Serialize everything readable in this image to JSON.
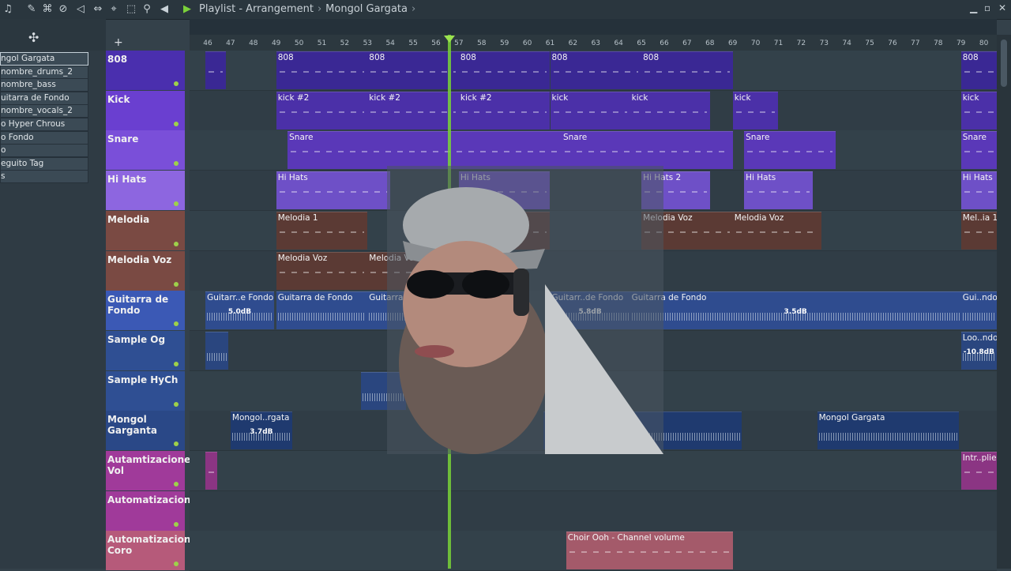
{
  "titlebar": {
    "crumb": [
      "Playlist - Arrangement",
      "Mongol Gargata"
    ]
  },
  "ruler": [
    46,
    47,
    48,
    49,
    50,
    51,
    52,
    53,
    54,
    55,
    56,
    57,
    58,
    59,
    60,
    61,
    62,
    63,
    64,
    65,
    66,
    67,
    68,
    69,
    70,
    71,
    72,
    73,
    74,
    75,
    76,
    77,
    78,
    79,
    80
  ],
  "picker": [
    "ngol Gargata",
    "nombre_drums_2",
    "nombre_bass",
    "uitarra de Fondo",
    "nombre_vocals_2",
    "o Hyper Chrous",
    "o Fondo",
    "o",
    "eguito Tag",
    "s"
  ],
  "tracks": [
    {
      "name": "808",
      "color": "#4a2fae"
    },
    {
      "name": "Kick",
      "color": "#6a3fd0"
    },
    {
      "name": "Snare",
      "color": "#7a4fd9"
    },
    {
      "name": "Hi Hats",
      "color": "#8d66e0"
    },
    {
      "name": "Melodia",
      "color": "#7a4a43"
    },
    {
      "name": "Melodia Voz",
      "color": "#7a4a43"
    },
    {
      "name": "Guitarra de Fondo",
      "color": "#3b59b5"
    },
    {
      "name": "Sample Og",
      "color": "#2f4f93"
    },
    {
      "name": "Sample HyCh",
      "color": "#2f4f93"
    },
    {
      "name": "Mongol Garganta",
      "color": "#2a4887"
    },
    {
      "name": "Autamtizaciones Vol",
      "color": "#a03a9a"
    },
    {
      "name": "Automatizaciones",
      "color": "#a03a9a"
    },
    {
      "name": "Automatizaciones Coro",
      "color": "#b65a7a"
    }
  ],
  "clips": [
    {
      "track": 0,
      "label": "",
      "start": 45.9,
      "len": 0.9,
      "kind": "pattern",
      "color": "#3a2894"
    },
    {
      "track": 0,
      "label": "808",
      "start": 49,
      "len": 4,
      "kind": "pattern",
      "color": "#3a2894"
    },
    {
      "track": 0,
      "label": "808",
      "start": 53,
      "len": 4,
      "kind": "pattern",
      "color": "#3a2894"
    },
    {
      "track": 0,
      "label": "808",
      "start": 57,
      "len": 4,
      "kind": "pattern",
      "color": "#3a2894"
    },
    {
      "track": 0,
      "label": "808",
      "start": 61,
      "len": 4,
      "kind": "pattern",
      "color": "#3a2894"
    },
    {
      "track": 0,
      "label": "808",
      "start": 65,
      "len": 4,
      "kind": "pattern",
      "color": "#3a2894"
    },
    {
      "track": 0,
      "label": "808",
      "start": 79,
      "len": 2,
      "kind": "pattern",
      "color": "#3a2894"
    },
    {
      "track": 1,
      "label": "kick #2",
      "start": 49,
      "len": 4,
      "kind": "pattern",
      "color": "#4b30a8"
    },
    {
      "track": 1,
      "label": "kick #2",
      "start": 53,
      "len": 4,
      "kind": "pattern",
      "color": "#4b30a8"
    },
    {
      "track": 1,
      "label": "kick #2",
      "start": 57,
      "len": 4,
      "kind": "pattern",
      "color": "#4b30a8"
    },
    {
      "track": 1,
      "label": "kick",
      "start": 61,
      "len": 3.5,
      "kind": "pattern",
      "color": "#4b30a8"
    },
    {
      "track": 1,
      "label": "kick",
      "start": 64.5,
      "len": 3.5,
      "kind": "pattern",
      "color": "#4b30a8"
    },
    {
      "track": 1,
      "label": "kick",
      "start": 69,
      "len": 2,
      "kind": "pattern",
      "color": "#4b30a8"
    },
    {
      "track": 1,
      "label": "kick",
      "start": 79,
      "len": 2,
      "kind": "pattern",
      "color": "#4b30a8"
    },
    {
      "track": 2,
      "label": "Snare",
      "start": 49.5,
      "len": 12,
      "kind": "pattern",
      "color": "#5a38b8"
    },
    {
      "track": 2,
      "label": "Snare",
      "start": 61.5,
      "len": 7.5,
      "kind": "pattern",
      "color": "#5a38b8"
    },
    {
      "track": 2,
      "label": "Snare",
      "start": 69.5,
      "len": 4,
      "kind": "pattern",
      "color": "#5a38b8"
    },
    {
      "track": 2,
      "label": "Snare",
      "start": 79,
      "len": 2,
      "kind": "pattern",
      "color": "#5a38b8"
    },
    {
      "track": 3,
      "label": "Hi Hats",
      "start": 49,
      "len": 5,
      "kind": "pattern",
      "color": "#6e50c7"
    },
    {
      "track": 3,
      "label": "Hi Hats",
      "start": 57,
      "len": 4,
      "kind": "pattern",
      "color": "#6e50c7"
    },
    {
      "track": 3,
      "label": "Hi Hats 2",
      "start": 65,
      "len": 3,
      "kind": "pattern",
      "color": "#6e50c7"
    },
    {
      "track": 3,
      "label": "Hi Hats",
      "start": 69.5,
      "len": 3,
      "kind": "pattern",
      "color": "#6e50c7"
    },
    {
      "track": 3,
      "label": "Hi Hats",
      "start": 79,
      "len": 2,
      "kind": "pattern",
      "color": "#6e50c7"
    },
    {
      "track": 4,
      "label": "Melodia 1",
      "start": 49,
      "len": 4,
      "kind": "pattern",
      "color": "#5b3a34"
    },
    {
      "track": 4,
      "label": "",
      "start": 57,
      "len": 4,
      "kind": "pattern",
      "color": "#5b3a34"
    },
    {
      "track": 4,
      "label": "Melodia Voz",
      "start": 65,
      "len": 4,
      "kind": "pattern",
      "color": "#5b3a34"
    },
    {
      "track": 4,
      "label": "Melodia Voz",
      "start": 69,
      "len": 3.9,
      "kind": "pattern",
      "color": "#5b3a34"
    },
    {
      "track": 4,
      "label": "Mel..ia 1",
      "start": 79,
      "len": 2,
      "kind": "pattern",
      "color": "#5b3a34"
    },
    {
      "track": 5,
      "label": "Melodia Voz",
      "start": 49,
      "len": 4,
      "kind": "pattern",
      "color": "#5b3a34"
    },
    {
      "track": 5,
      "label": "Melodia Voz",
      "start": 53,
      "len": 4,
      "kind": "pattern",
      "color": "#5b3a34"
    },
    {
      "track": 6,
      "label": "Guitarr..e Fondo",
      "start": 45.9,
      "len": 3,
      "kind": "audio",
      "color": "#2f4c8f",
      "db": "5.0dB"
    },
    {
      "track": 6,
      "label": "Guitarra de Fondo",
      "start": 49,
      "len": 4,
      "kind": "audio",
      "color": "#2f4c8f"
    },
    {
      "track": 6,
      "label": "Guitarra de Fondo",
      "start": 53,
      "len": 4,
      "kind": "audio",
      "color": "#2f4c8f"
    },
    {
      "track": 6,
      "label": "Guitarr..de Fondo",
      "start": 61,
      "len": 3.5,
      "kind": "audio",
      "color": "#2f4c8f",
      "db": "5.8dB"
    },
    {
      "track": 6,
      "label": "Guitarra de Fondo",
      "start": 64.5,
      "len": 14.5,
      "kind": "audio",
      "color": "#2f4c8f",
      "db": "3.5dB"
    },
    {
      "track": 6,
      "label": "Gui..ndo",
      "start": 79,
      "len": 2,
      "kind": "audio",
      "color": "#2f4c8f"
    },
    {
      "track": 7,
      "label": "",
      "start": 45.9,
      "len": 1,
      "kind": "audio",
      "color": "#2a467f"
    },
    {
      "track": 7,
      "label": "Loo..ndo",
      "start": 79,
      "len": 2,
      "kind": "audio",
      "color": "#2a467f",
      "db": "-10.8dB"
    },
    {
      "track": 8,
      "label": "",
      "start": 52.7,
      "len": 2,
      "kind": "audio",
      "color": "#2a467f"
    },
    {
      "track": 8,
      "label": "",
      "start": 55,
      "len": 1.5,
      "kind": "audio",
      "color": "#2a467f"
    },
    {
      "track": 9,
      "label": "Mongol..rgata",
      "start": 47,
      "len": 2.7,
      "kind": "audio",
      "color": "#1f3a6f",
      "db": "3.7dB"
    },
    {
      "track": 9,
      "label": "Mongol Gargata",
      "start": 60.7,
      "len": 8.7,
      "kind": "audio",
      "color": "#1f3a6f"
    },
    {
      "track": 9,
      "label": "Mongol Gargata",
      "start": 72.7,
      "len": 6.2,
      "kind": "audio",
      "color": "#1f3a6f"
    },
    {
      "track": 10,
      "label": "",
      "start": 45.9,
      "len": 0.5,
      "kind": "auto",
      "color": "#8b3583"
    },
    {
      "track": 10,
      "label": "Intr..plier",
      "start": 79,
      "len": 2,
      "kind": "auto",
      "color": "#8b3583"
    },
    {
      "track": 12,
      "label": "Choir Ooh - Channel volume",
      "start": 61.7,
      "len": 7.3,
      "kind": "auto",
      "color": "#a45a6a"
    }
  ]
}
